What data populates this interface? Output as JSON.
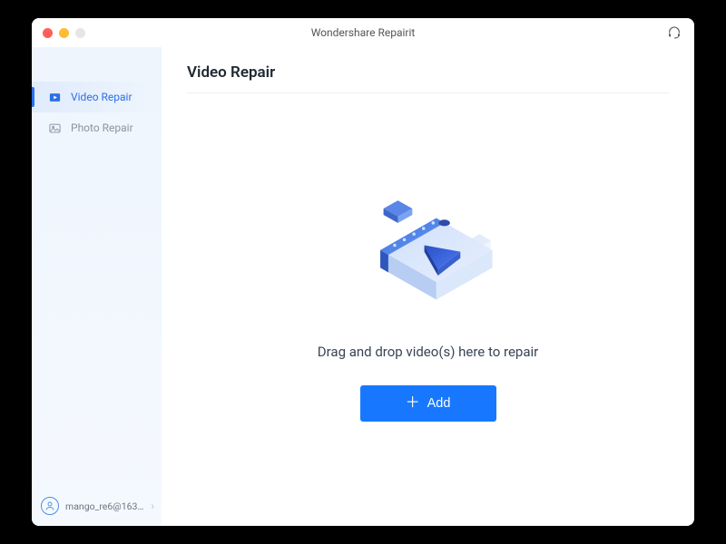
{
  "window": {
    "title": "Wondershare Repairit"
  },
  "sidebar": {
    "items": [
      {
        "label": "Video Repair",
        "icon": "video-icon",
        "active": true
      },
      {
        "label": "Photo Repair",
        "icon": "photo-icon",
        "active": false
      }
    ]
  },
  "account": {
    "name": "mango_re6@163...."
  },
  "main": {
    "page_title": "Video Repair",
    "drop_text": "Drag and drop video(s) here to repair",
    "add_label": "Add"
  }
}
